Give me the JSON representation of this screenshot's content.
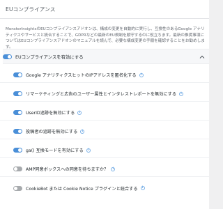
{
  "section": {
    "title": "EUコンプライアンス",
    "description": "MonsterInsightsのEUコンプライアンスアドオンは、構成の変更を自動的に実行し、互換性のあるGoogle アナリティクスやサービスと統合することで、GDPRなどの最新のEU規制を順守するのに役立ちます。最新の推奨事項についてはEUコンプライアンスアドオンのマニュアルを読んで、必要な構成変更の手順を確認することをお勧めします。"
  },
  "main_toggle": {
    "label": "EUコンプライアンスを有効にする",
    "enabled": true
  },
  "options": [
    {
      "label": "Google アナリティクスヒットのIPアドレスを匿名化する",
      "enabled": true
    },
    {
      "label": "リマーケティングと広告のユーザー属性とインタレストレポートを無効にする",
      "enabled": true
    },
    {
      "label": "UserID追跡を無効にする",
      "enabled": true
    },
    {
      "label": "投稿者の追跡を無効にする",
      "enabled": true
    },
    {
      "label": "ga() 互換モードを有効にする",
      "enabled": true
    },
    {
      "label": "AMP同意ボックスへの同意を待ちますか？",
      "enabled": false
    },
    {
      "label": "CookieBot または Cookie Notice プラグインと統合する",
      "enabled": false
    }
  ],
  "icons": {
    "info": "info-icon",
    "collapse": "chevron-up-icon"
  },
  "colors": {
    "accent": "#4a8fd8",
    "toggle_off": "#a7aaad",
    "info": "#7ab0e6"
  }
}
